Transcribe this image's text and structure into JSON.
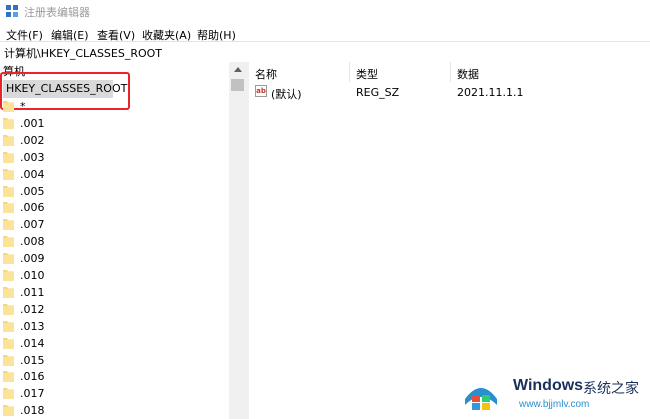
{
  "window": {
    "title": "注册表编辑器"
  },
  "menu": [
    "文件(F)",
    "编辑(E)",
    "查看(V)",
    "收藏夹(A)",
    "帮助(H)"
  ],
  "address": "计算机\\HKEY_CLASSES_ROOT",
  "tree": {
    "root_label": "算机",
    "selected": "HKEY_CLASSES_ROOT",
    "items": [
      "*",
      ".001",
      ".002",
      ".003",
      ".004",
      ".005",
      ".006",
      ".007",
      ".008",
      ".009",
      ".010",
      ".011",
      ".012",
      ".013",
      ".014",
      ".015",
      ".016",
      ".017",
      ".018"
    ]
  },
  "list": {
    "columns": [
      "名称",
      "类型",
      "数据"
    ],
    "rows": [
      {
        "name": "(默认)",
        "type": "REG_SZ",
        "data": "2021.11.1.1"
      }
    ]
  },
  "watermark": {
    "brand": "Windows",
    "brand_cn": "系统之家",
    "url": "www.bjjmlv.com"
  },
  "colors": {
    "highlight": "#e8262a",
    "selection": "#d9d9d9",
    "folder": "#f8d775"
  }
}
